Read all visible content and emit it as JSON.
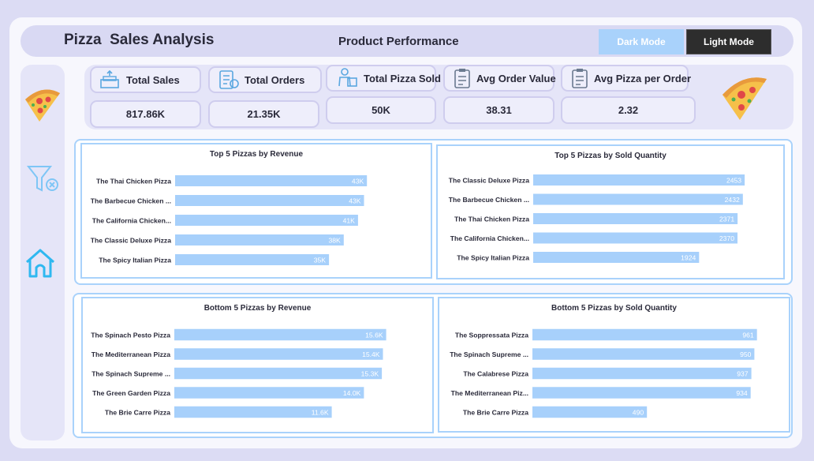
{
  "header": {
    "app_title": "Pizza  Sales Analysis",
    "page_title": "Product Performance",
    "dark_mode_label": "Dark Mode",
    "light_mode_label": "Light Mode"
  },
  "sidebar": {
    "icons": [
      "pizza-slice-icon",
      "clear-filter-icon",
      "home-icon"
    ]
  },
  "kpis": [
    {
      "label": "Total Sales",
      "value": "817.86K",
      "icon": "money-icon"
    },
    {
      "label": "Total Orders",
      "value": "21.35K",
      "icon": "order-list-icon"
    },
    {
      "label": "Total Pizza Sold",
      "value": "50K",
      "icon": "delivery-icon"
    },
    {
      "label": "Avg Order Value",
      "value": "38.31",
      "icon": "clipboard-icon"
    },
    {
      "label": "Avg Pizza per Order",
      "value": "2.32",
      "icon": "clipboard-icon"
    }
  ],
  "colors": {
    "bar": "#a7d0fb",
    "panel_border": "#a9d2fb",
    "text": "#2a2a3a"
  },
  "chart_data": [
    {
      "type": "bar",
      "orientation": "horizontal",
      "title": "Top 5 Pizzas by Revenue",
      "categories": [
        "The Thai Chicken Pizza",
        "The Barbecue Chicken ...",
        "The California Chicken...",
        "The Classic Deluxe Pizza",
        "The Spicy Italian Pizza"
      ],
      "values": [
        43434,
        42768,
        41410,
        38180,
        34831
      ],
      "data_labels": [
        "43K",
        "43K",
        "41K",
        "38K",
        "35K"
      ],
      "xlim": [
        0,
        50000
      ]
    },
    {
      "type": "bar",
      "orientation": "horizontal",
      "title": "Top 5 Pizzas by Sold Quantity",
      "categories": [
        "The Classic Deluxe Pizza",
        "The Barbecue Chicken ...",
        "The Thai Chicken Pizza",
        "The California Chicken...",
        "The Spicy Italian Pizza"
      ],
      "values": [
        2453,
        2432,
        2371,
        2370,
        1924
      ],
      "data_labels": [
        "2453",
        "2432",
        "2371",
        "2370",
        "1924"
      ],
      "xlim": [
        0,
        2800
      ]
    },
    {
      "type": "bar",
      "orientation": "horizontal",
      "title": "Bottom 5 Pizzas by Revenue",
      "categories": [
        "The Spinach Pesto Pizza",
        "The Mediterranean Pizza",
        "The Spinach Supreme ...",
        "The Green Garden Pizza",
        "The Brie Carre Pizza"
      ],
      "values": [
        15596,
        15360,
        15277,
        13956,
        11588
      ],
      "data_labels": [
        "15.6K",
        "15.4K",
        "15.3K",
        "14.0K",
        "11.6K"
      ],
      "xlim": [
        0,
        18000
      ]
    },
    {
      "type": "bar",
      "orientation": "horizontal",
      "title": "Bottom 5 Pizzas by Sold Quantity",
      "categories": [
        "The Soppressata Pizza",
        "The Spinach Supreme ...",
        "The Calabrese Pizza",
        "The Mediterranean Piz...",
        "The Brie Carre Pizza"
      ],
      "values": [
        961,
        950,
        937,
        934,
        490
      ],
      "data_labels": [
        "961",
        "950",
        "937",
        "934",
        "490"
      ],
      "xlim": [
        0,
        1060
      ]
    }
  ]
}
